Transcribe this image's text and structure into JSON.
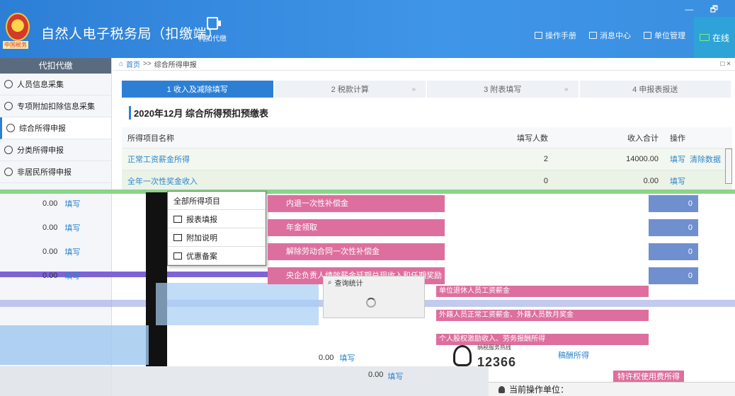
{
  "app": {
    "title": "自然人电子税务局（扣缴端）",
    "emblem_caption": "中国税务",
    "proxy_nav_label": "代扣代缴",
    "window_controls": "— 🗗",
    "top_links": [
      {
        "label": "操作手册",
        "icon": "book-icon"
      },
      {
        "label": "消息中心",
        "icon": "mail-icon"
      },
      {
        "label": "单位管理",
        "icon": "building-icon"
      }
    ],
    "online_label": "在线"
  },
  "sidebar": {
    "header": "代扣代缴",
    "items": [
      {
        "label": "人员信息采集",
        "icon": "user-icon"
      },
      {
        "label": "专项附加扣除信息采集",
        "icon": "list-icon"
      },
      {
        "label": "综合所得申报",
        "icon": "layers-icon",
        "active": true
      },
      {
        "label": "分类所得申报",
        "icon": "clock-icon"
      },
      {
        "label": "非居民所得申报",
        "icon": "person-icon"
      }
    ]
  },
  "breadcrumb": {
    "home": "首页",
    "separator": ">>",
    "current": "综合所得申报"
  },
  "steps": [
    {
      "label": "1 收入及减除填写",
      "active": true
    },
    {
      "label": "2 税款计算",
      "active": false
    },
    {
      "label": "3 附表填写",
      "active": false
    },
    {
      "label": "4 申报表报送",
      "active": false
    }
  ],
  "table": {
    "title": "2020年12月 综合所得预扣预缴表",
    "columns": [
      "所得项目名称",
      "填写人数",
      "收入合计",
      "操作"
    ],
    "rows": [
      {
        "name": "正常工资薪金所得",
        "count": "2",
        "income": "14000.00",
        "actions": [
          "填写",
          "清除数据"
        ]
      },
      {
        "name": "全年一次性奖金收入",
        "count": "0",
        "income": "0.00",
        "actions": [
          "填写"
        ]
      }
    ]
  },
  "submenu": {
    "header": "全部所得项目",
    "items": [
      "报表填报",
      "附加说明",
      "优惠备案"
    ]
  },
  "item_menu": [
    "内退一次性补偿金",
    "年金领取",
    "解除劳动合同一次性补偿金",
    "央企负责人绩效薪金延期兑现收入和任期奖励"
  ],
  "left_values": [
    {
      "value": "0.00",
      "link": "填写"
    },
    {
      "value": "0.00",
      "link": "填写"
    },
    {
      "value": "0.00",
      "link": "填写"
    },
    {
      "value": "0.00",
      "link": "填写"
    }
  ],
  "right_zeros": [
    "0",
    "0",
    "0",
    "0"
  ],
  "query": {
    "label": "查询统计"
  },
  "right_links": [
    "单位退休人员工资薪金",
    "外籍人员正常工资薪金、外籍人员数月奖金",
    "个人股权激励收入、劳务报酬所得"
  ],
  "hotline": {
    "label": "纳税服务热线",
    "number": "12366"
  },
  "remuneration_link": "稿酬所得",
  "bottom_rows": [
    {
      "value": "0.00",
      "link": "填写"
    },
    {
      "value": "0.00",
      "link": "填写"
    }
  ],
  "grant_link": "特许权使用费所得",
  "status": {
    "label": "当前操作单位："
  },
  "colors": {
    "header": "#2d7fd6",
    "accent": "#2d7fd6",
    "row": "#eaf3e6",
    "pink": "#dd6f9e",
    "link": "#2f84cf"
  }
}
